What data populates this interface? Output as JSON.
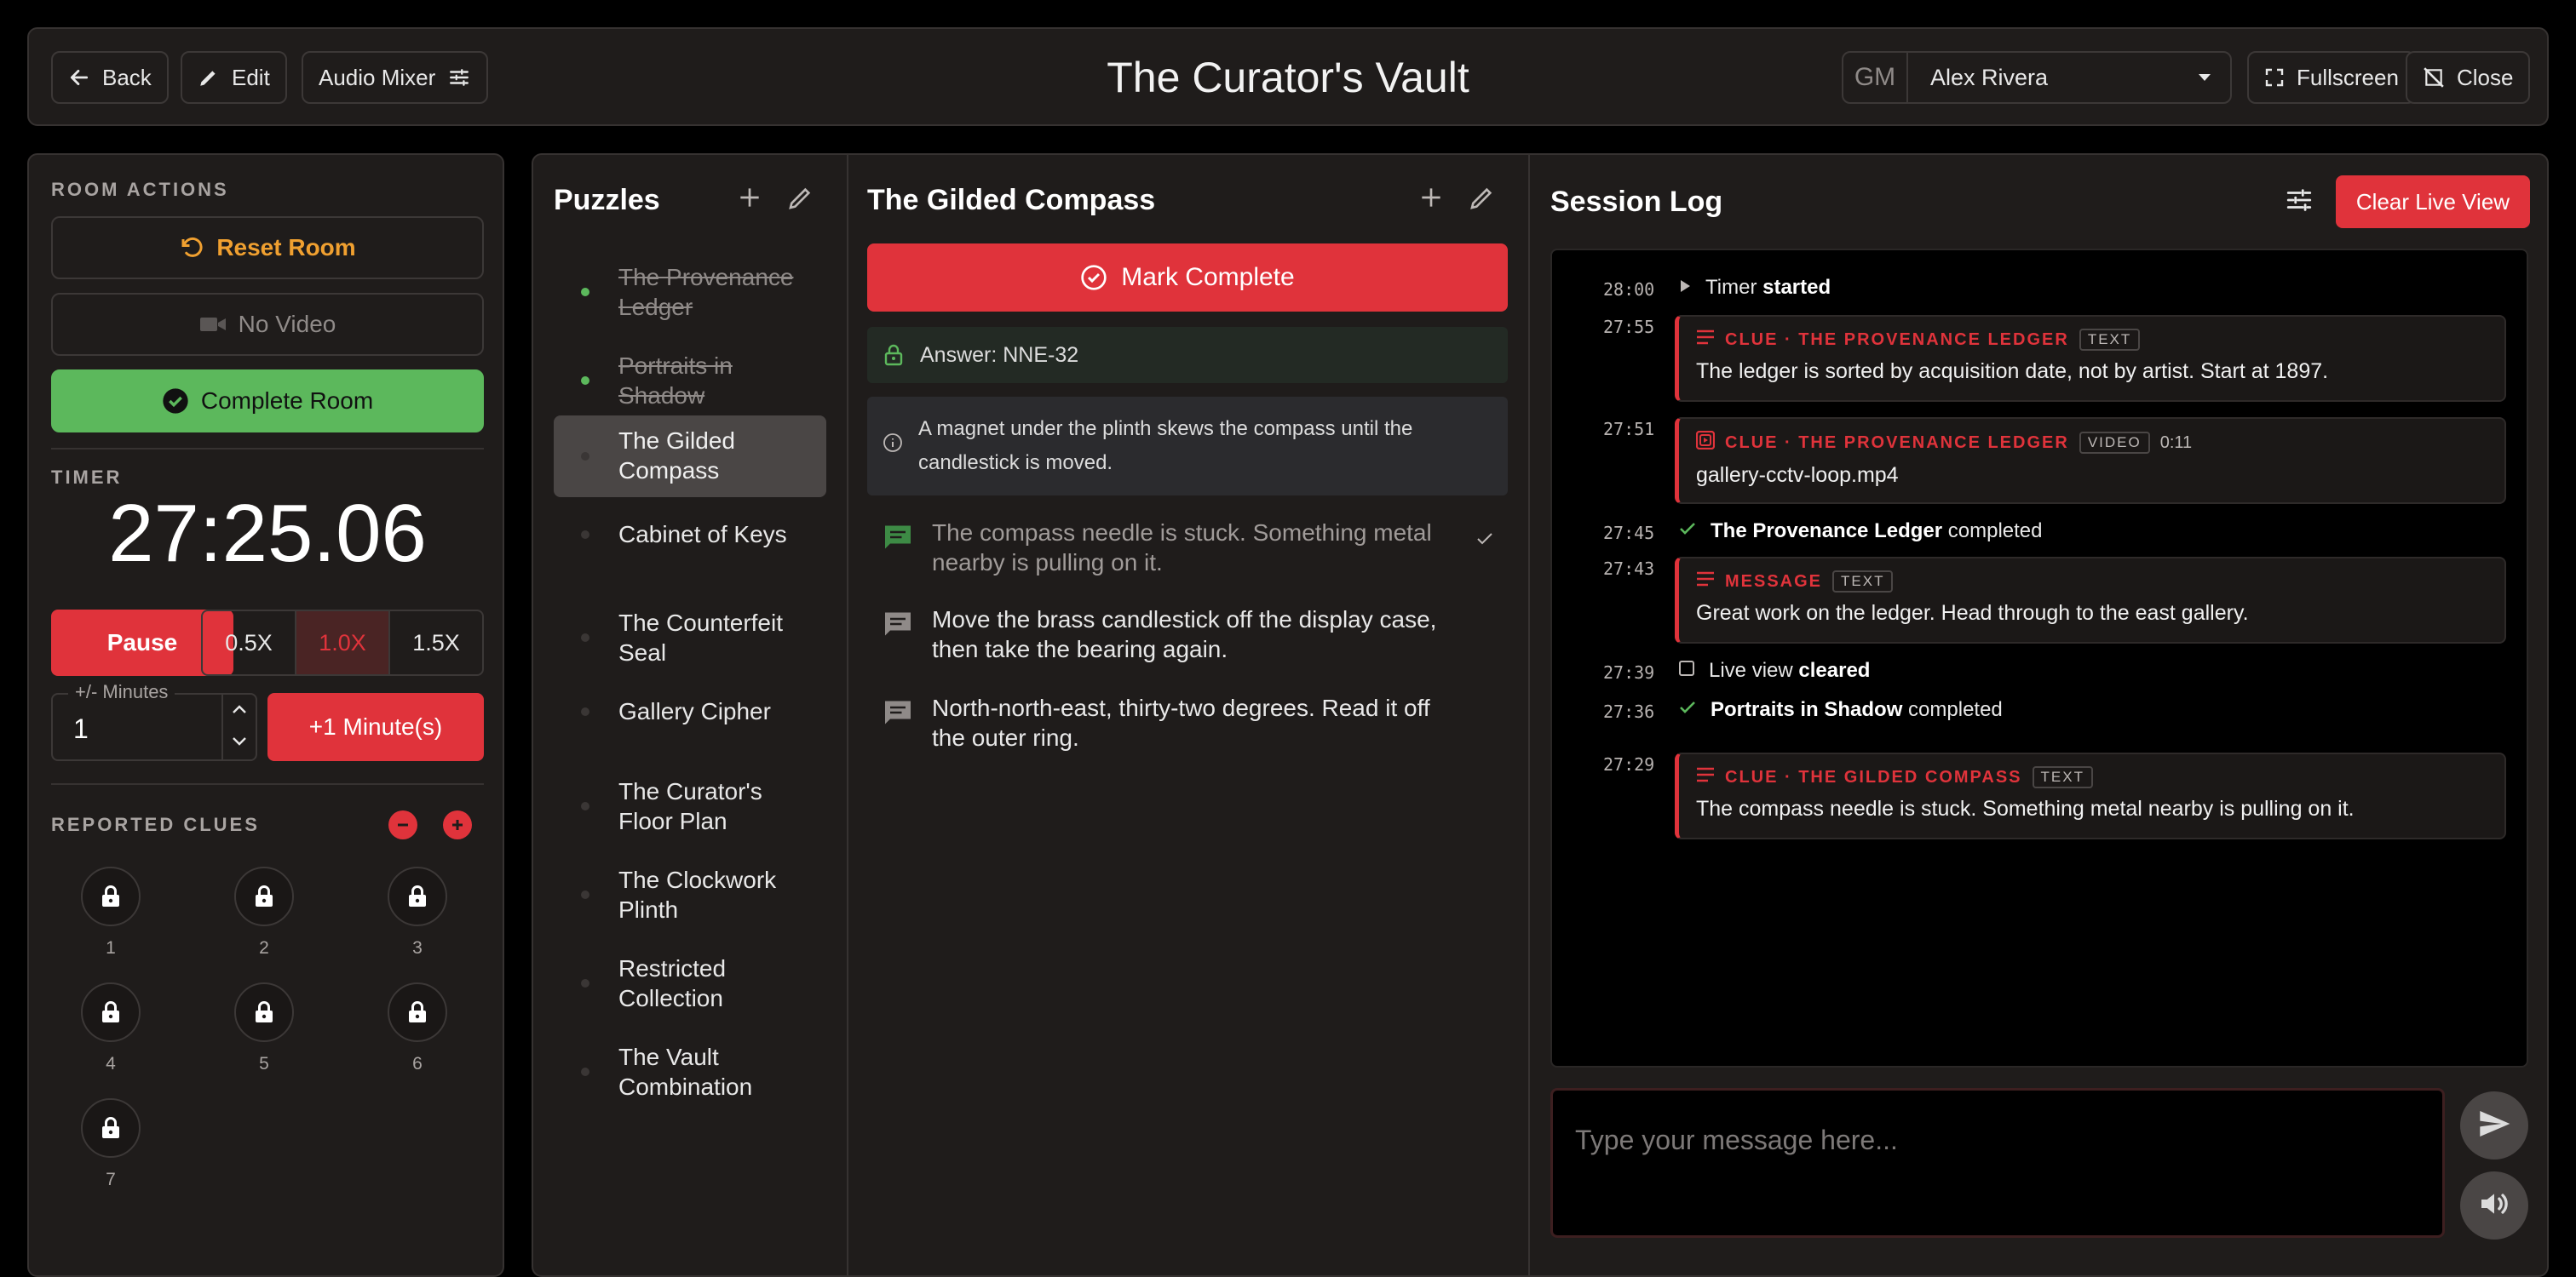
{
  "header": {
    "back_label": "Back",
    "edit_label": "Edit",
    "audio_mixer_label": "Audio Mixer",
    "title": "The Curator's Vault",
    "gm_label": "GM",
    "gm_name": "Alex Rivera",
    "fullscreen_label": "Fullscreen",
    "close_label": "Close"
  },
  "room_actions": {
    "label": "ROOM ACTIONS",
    "reset_label": "Reset Room",
    "no_video_label": "No Video",
    "complete_label": "Complete Room"
  },
  "timer": {
    "label": "TIMER",
    "display": "27:25.06",
    "pause_label": "Pause",
    "speeds": [
      "0.5X",
      "1.0X",
      "1.5X"
    ],
    "active_speed": "1.0X",
    "minutes_label": "+/- Minutes",
    "minutes_value": "1",
    "add_minutes_label": "+1 Minute(s)"
  },
  "reported_clues": {
    "label": "REPORTED CLUES",
    "locks": [
      "1",
      "2",
      "3",
      "4",
      "5",
      "6",
      "7"
    ]
  },
  "puzzles": {
    "title": "Puzzles",
    "items": [
      {
        "name": "The Provenance Ledger",
        "status": "done"
      },
      {
        "name": "Portraits in Shadow",
        "status": "done"
      },
      {
        "name": "The Gilded Compass",
        "status": "active"
      },
      {
        "name": "Cabinet of Keys",
        "status": "pending"
      },
      {
        "name": "The Counterfeit Seal",
        "status": "pending"
      },
      {
        "name": "Gallery Cipher",
        "status": "pending"
      },
      {
        "name": "The Curator's Floor Plan",
        "status": "pending"
      },
      {
        "name": "The Clockwork Plinth",
        "status": "pending"
      },
      {
        "name": "Restricted Collection",
        "status": "pending"
      },
      {
        "name": "The Vault Combination",
        "status": "pending"
      }
    ]
  },
  "detail": {
    "title": "The Gilded Compass",
    "mark_complete_label": "Mark Complete",
    "answer": "Answer: NNE-32",
    "note": "A magnet under the plinth skews the compass until the candlestick is moved.",
    "hints": [
      {
        "text": "The compass needle is stuck. Something metal nearby is pulling on it.",
        "used": true
      },
      {
        "text": "Move the brass candlestick off the display case, then take the bearing again.",
        "used": false
      },
      {
        "text": "North-north-east, thirty-two degrees. Read it off the outer ring.",
        "used": false
      }
    ]
  },
  "session_log": {
    "title": "Session Log",
    "clear_label": "Clear Live View",
    "entries": [
      {
        "time": "28:00",
        "kind": "event",
        "icon": "play",
        "text": "Timer",
        "bold": "started"
      },
      {
        "time": "27:55",
        "kind": "card",
        "icon": "lines",
        "head": "CLUE · THE PROVENANCE LEDGER",
        "tag": "TEXT",
        "body": "The ledger is sorted by acquisition date, not by artist. Start at 1897."
      },
      {
        "time": "27:51",
        "kind": "card",
        "icon": "video",
        "head": "CLUE · THE PROVENANCE LEDGER",
        "tag": "VIDEO",
        "duration": "0:11",
        "body": "gallery-cctv-loop.mp4"
      },
      {
        "time": "27:45",
        "kind": "event",
        "icon": "check",
        "bold_first": "The Provenance Ledger",
        "text": "completed"
      },
      {
        "time": "27:43",
        "kind": "card",
        "icon": "lines",
        "head": "MESSAGE",
        "tag": "TEXT",
        "body": "Great work on the ledger. Head through to the east gallery."
      },
      {
        "time": "27:39",
        "kind": "event",
        "icon": "square",
        "text": "Live view",
        "bold": "cleared"
      },
      {
        "time": "27:36",
        "kind": "event",
        "icon": "check",
        "bold_first": "Portraits in Shadow",
        "text": "completed"
      },
      {
        "time": "27:29",
        "kind": "card",
        "icon": "lines",
        "head": "CLUE · THE GILDED COMPASS",
        "tag": "TEXT",
        "body": "The compass needle is stuck. Something metal nearby is pulling on it."
      }
    ]
  },
  "message": {
    "placeholder": "Type your message here..."
  },
  "colors": {
    "accent_red": "#e0333b",
    "success_green": "#5cb85c",
    "warning_orange": "#f0a030",
    "panel_bg": "#1f1c1b"
  }
}
